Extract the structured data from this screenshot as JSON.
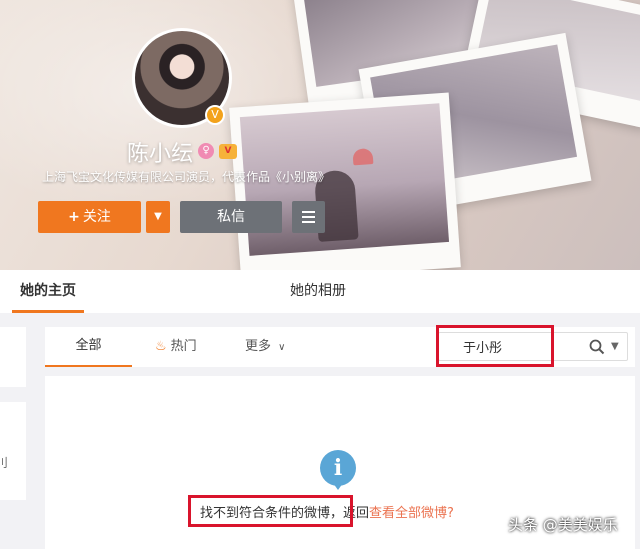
{
  "profile": {
    "name": "陈小纭",
    "verify_desc": "上海飞宝文化传媒有限公司演员，代表作品《小别离》",
    "gender_icon": "female-icon",
    "member_icon": "vip-icon"
  },
  "actions": {
    "follow_plus": "+",
    "follow_label": "关注",
    "message_label": "私信"
  },
  "tabs": {
    "home": "她的主页",
    "album": "她的相册"
  },
  "filters": {
    "all": "全部",
    "hot": "热门",
    "more": "更多"
  },
  "search": {
    "value": "于小彤"
  },
  "result": {
    "info_glyph": "i",
    "message": "找不到符合条件的微博，",
    "return_text": "返回",
    "link_text": "查看全部微博?"
  },
  "left": {
    "edge_char": "刂"
  },
  "watermark": "头条 @美美娱乐",
  "colors": {
    "accent": "#f0771f",
    "highlight": "#d9142c",
    "link": "#eb7350",
    "info": "#5aa6d6"
  }
}
